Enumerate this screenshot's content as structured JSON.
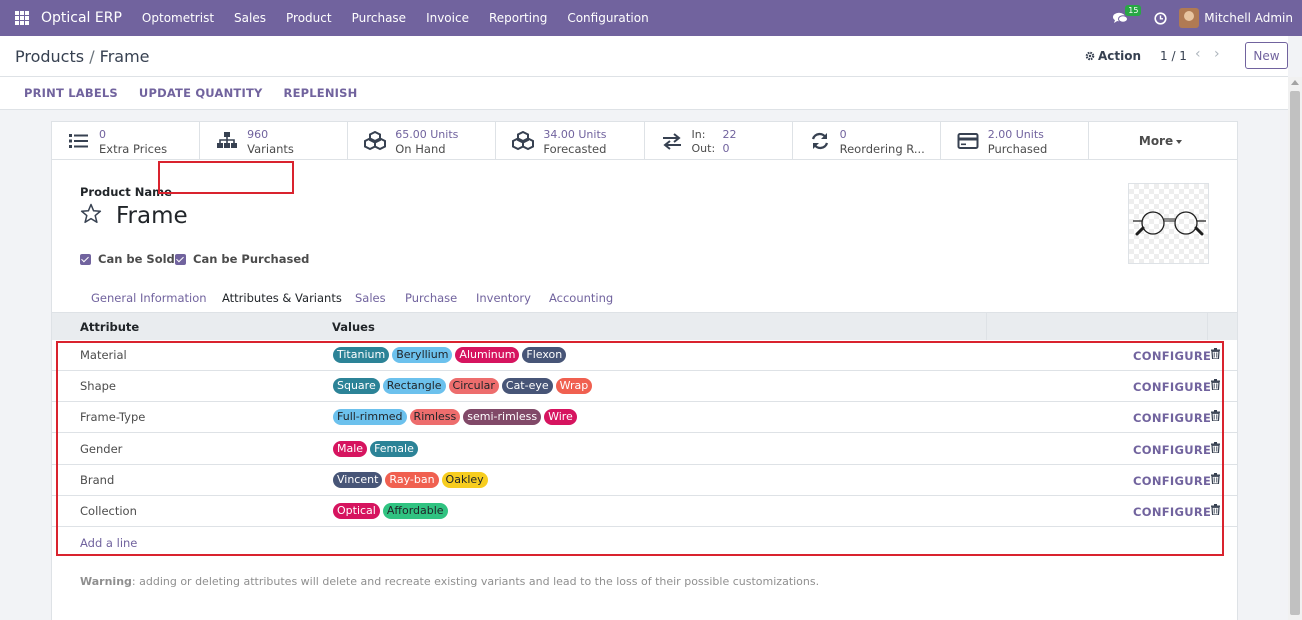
{
  "navbar": {
    "brand": "Optical ERP",
    "menu": [
      "Optometrist",
      "Sales",
      "Product",
      "Purchase",
      "Invoice",
      "Reporting",
      "Configuration"
    ],
    "message_count": "15",
    "user": "Mitchell Admin",
    "bg_color": "#71639e"
  },
  "control": {
    "breadcrumb_parent": "Products",
    "breadcrumb_sep": "/",
    "breadcrumb_current": "Frame",
    "action_label": "Action",
    "pager": "1 / 1",
    "new_label": "New"
  },
  "header_buttons": [
    "PRINT LABELS",
    "UPDATE QUANTITY",
    "REPLENISH"
  ],
  "smart_buttons": [
    {
      "icon": "list-icon",
      "value": "0",
      "label": "Extra Prices"
    },
    {
      "icon": "sitemap-icon",
      "value": "960",
      "label": "Variants"
    },
    {
      "icon": "cubes-icon",
      "value": "65.00 Units",
      "label": "On Hand"
    },
    {
      "icon": "cubes-icon",
      "value": "34.00 Units",
      "label": "Forecasted"
    },
    {
      "icon": "exchange-icon",
      "in_label": "In:",
      "in_value": "22",
      "out_label": "Out:",
      "out_value": "0"
    },
    {
      "icon": "refresh-icon",
      "value": "0",
      "label": "Reordering R..."
    },
    {
      "icon": "credit-card-icon",
      "value": "2.00 Units",
      "label": "Purchased"
    }
  ],
  "more_label": "More",
  "product": {
    "name_label": "Product Name",
    "name": "Frame",
    "can_be_sold": "Can be Sold",
    "can_be_purchased": "Can be Purchased"
  },
  "tabs": [
    "General Information",
    "Attributes & Variants",
    "Sales",
    "Purchase",
    "Inventory",
    "Accounting"
  ],
  "active_tab": "Attributes & Variants",
  "table": {
    "col_attribute": "Attribute",
    "col_values": "Values",
    "configure_label": "CONFIGURE",
    "add_line": "Add a line",
    "rows": [
      {
        "attribute": "Material",
        "values": [
          {
            "name": "Titanium",
            "color": "#2c8397",
            "text": "#ffffff"
          },
          {
            "name": "Beryllium",
            "color": "#6cc1ed",
            "text": "#212529"
          },
          {
            "name": "Aluminum",
            "color": "#d6145f",
            "text": "#ffffff"
          },
          {
            "name": "Flexon",
            "color": "#475577",
            "text": "#ffffff"
          }
        ]
      },
      {
        "attribute": "Shape",
        "values": [
          {
            "name": "Square",
            "color": "#2c8397",
            "text": "#ffffff"
          },
          {
            "name": "Rectangle",
            "color": "#6cc1ed",
            "text": "#212529"
          },
          {
            "name": "Circular",
            "color": "#ed6d6d",
            "text": "#212529"
          },
          {
            "name": "Cat-eye",
            "color": "#475577",
            "text": "#ffffff"
          },
          {
            "name": "Wrap",
            "color": "#f06050",
            "text": "#ffffff"
          }
        ]
      },
      {
        "attribute": "Frame-Type",
        "values": [
          {
            "name": "Full-rimmed",
            "color": "#6cc1ed",
            "text": "#212529"
          },
          {
            "name": "Rimless",
            "color": "#ed6d6d",
            "text": "#212529"
          },
          {
            "name": "semi-rimless",
            "color": "#814968",
            "text": "#ffffff"
          },
          {
            "name": "Wire",
            "color": "#d6145f",
            "text": "#ffffff"
          }
        ]
      },
      {
        "attribute": "Gender",
        "values": [
          {
            "name": "Male",
            "color": "#d6145f",
            "text": "#ffffff"
          },
          {
            "name": "Female",
            "color": "#2c8397",
            "text": "#ffffff"
          }
        ]
      },
      {
        "attribute": "Brand",
        "values": [
          {
            "name": "Vincent",
            "color": "#475577",
            "text": "#ffffff"
          },
          {
            "name": "Ray-ban",
            "color": "#f06050",
            "text": "#ffffff"
          },
          {
            "name": "Oakley",
            "color": "#f7cd1f",
            "text": "#212529"
          }
        ]
      },
      {
        "attribute": "Collection",
        "values": [
          {
            "name": "Optical",
            "color": "#d6145f",
            "text": "#ffffff"
          },
          {
            "name": "Affordable",
            "color": "#30c381",
            "text": "#212529"
          }
        ]
      }
    ]
  },
  "warning": {
    "bold": "Warning",
    "text": ": adding or deleting attributes will delete and recreate existing variants and lead to the loss of their possible customizations."
  }
}
